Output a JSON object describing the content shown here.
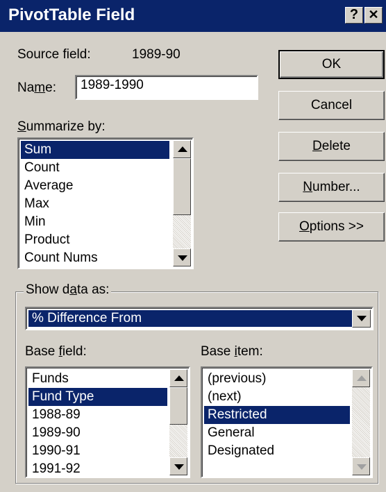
{
  "window": {
    "title": "PivotTable Field",
    "help_label": "?",
    "close_label": "✕"
  },
  "source": {
    "label": "Source field:",
    "value": "1989-90"
  },
  "name": {
    "label_pre": "Na",
    "label_key": "m",
    "label_post": "e:",
    "value": "1989-1990"
  },
  "summarize": {
    "label_key": "S",
    "label_post": "ummarize by:",
    "items": [
      "Sum",
      "Count",
      "Average",
      "Max",
      "Min",
      "Product",
      "Count Nums"
    ],
    "selected": "Sum"
  },
  "buttons": {
    "ok": "OK",
    "cancel": "Cancel",
    "delete_key": "D",
    "delete_post": "elete",
    "number_key": "N",
    "number_post": "umber...",
    "options_key": "O",
    "options_post": "ptions >>"
  },
  "show_data": {
    "label_pre": "Show d",
    "label_key": "a",
    "label_post": "ta as:",
    "value": "% Difference From"
  },
  "base_field": {
    "label_pre": "Base ",
    "label_key": "f",
    "label_post": "ield:",
    "items": [
      "Funds",
      "Fund Type",
      "1988-89",
      "1989-90",
      "1990-91",
      "1991-92"
    ],
    "selected": "Fund Type"
  },
  "base_item": {
    "label_pre": "Base ",
    "label_key": "i",
    "label_post": "tem:",
    "items": [
      "(previous)",
      "(next)",
      "Restricted",
      "General",
      "Designated"
    ],
    "selected": "Restricted"
  }
}
